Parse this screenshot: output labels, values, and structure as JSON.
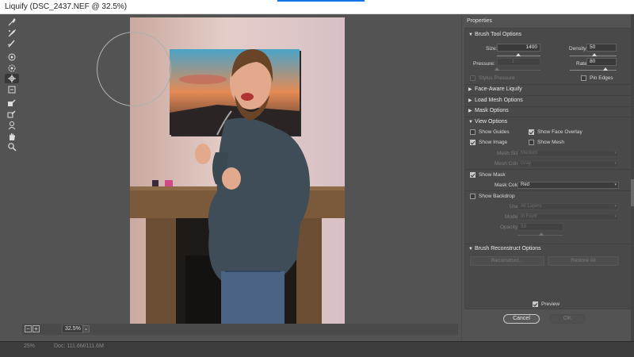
{
  "window": {
    "title": "Liquify (DSC_2437.NEF @ 32.5%)"
  },
  "toolbar": {
    "tools": [
      {
        "icon": "forward-warp-icon"
      },
      {
        "icon": "reconstruct-icon"
      },
      {
        "icon": "smooth-icon"
      },
      {
        "icon": "twirl-clockwise-icon"
      },
      {
        "icon": "pucker-icon"
      },
      {
        "icon": "bloat-icon"
      },
      {
        "icon": "push-left-icon"
      },
      {
        "icon": "freeze-mask-icon"
      },
      {
        "icon": "thaw-mask-icon"
      },
      {
        "icon": "face-tool-icon"
      },
      {
        "icon": "hand-icon"
      },
      {
        "icon": "zoom-icon"
      }
    ]
  },
  "canvas": {
    "zoom_value": "32.5%",
    "zoom_minus": "−",
    "zoom_plus": "+"
  },
  "status": {
    "zoom": "25%",
    "doc": "Doc: 111.6M/111.6M"
  },
  "panel": {
    "title": "Properties",
    "brush_tool_options": {
      "heading": "Brush Tool Options",
      "size_label": "Size:",
      "size_value": "1400",
      "density_label": "Density:",
      "density_value": "50",
      "pressure_label": "Pressure:",
      "pressure_value": "1",
      "rate_label": "Rate:",
      "rate_value": "80",
      "stylus_pressure_label": "Stylus Pressure",
      "pin_edges_label": "Pin Edges"
    },
    "face_aware": {
      "heading": "Face-Aware Liquify"
    },
    "load_mesh": {
      "heading": "Load Mesh Options"
    },
    "mask_options": {
      "heading": "Mask Options"
    },
    "view_options": {
      "heading": "View Options",
      "show_guides_label": "Show Guides",
      "show_face_overlay_label": "Show Face Overlay",
      "show_image_label": "Show Image",
      "show_mesh_label": "Show Mesh",
      "mesh_size_label": "Mesh Size:",
      "mesh_size_value": "Medium",
      "mesh_color_label": "Mesh Color:",
      "mesh_color_value": "Gray",
      "show_mask_label": "Show Mask",
      "mask_color_label": "Mask Color:",
      "mask_color_value": "Red",
      "show_backdrop_label": "Show Backdrop",
      "use_label": "Use:",
      "use_value": "All Layers",
      "mode_label": "Mode:",
      "mode_value": "In Front",
      "opacity_label": "Opacity:",
      "opacity_value": "50"
    },
    "brush_reconstruct": {
      "heading": "Brush Reconstruct Options",
      "reconstruct_label": "Reconstruct...",
      "restore_all_label": "Restore All"
    },
    "preview_label": "Preview",
    "cancel_label": "Cancel",
    "ok_label": "OK"
  }
}
